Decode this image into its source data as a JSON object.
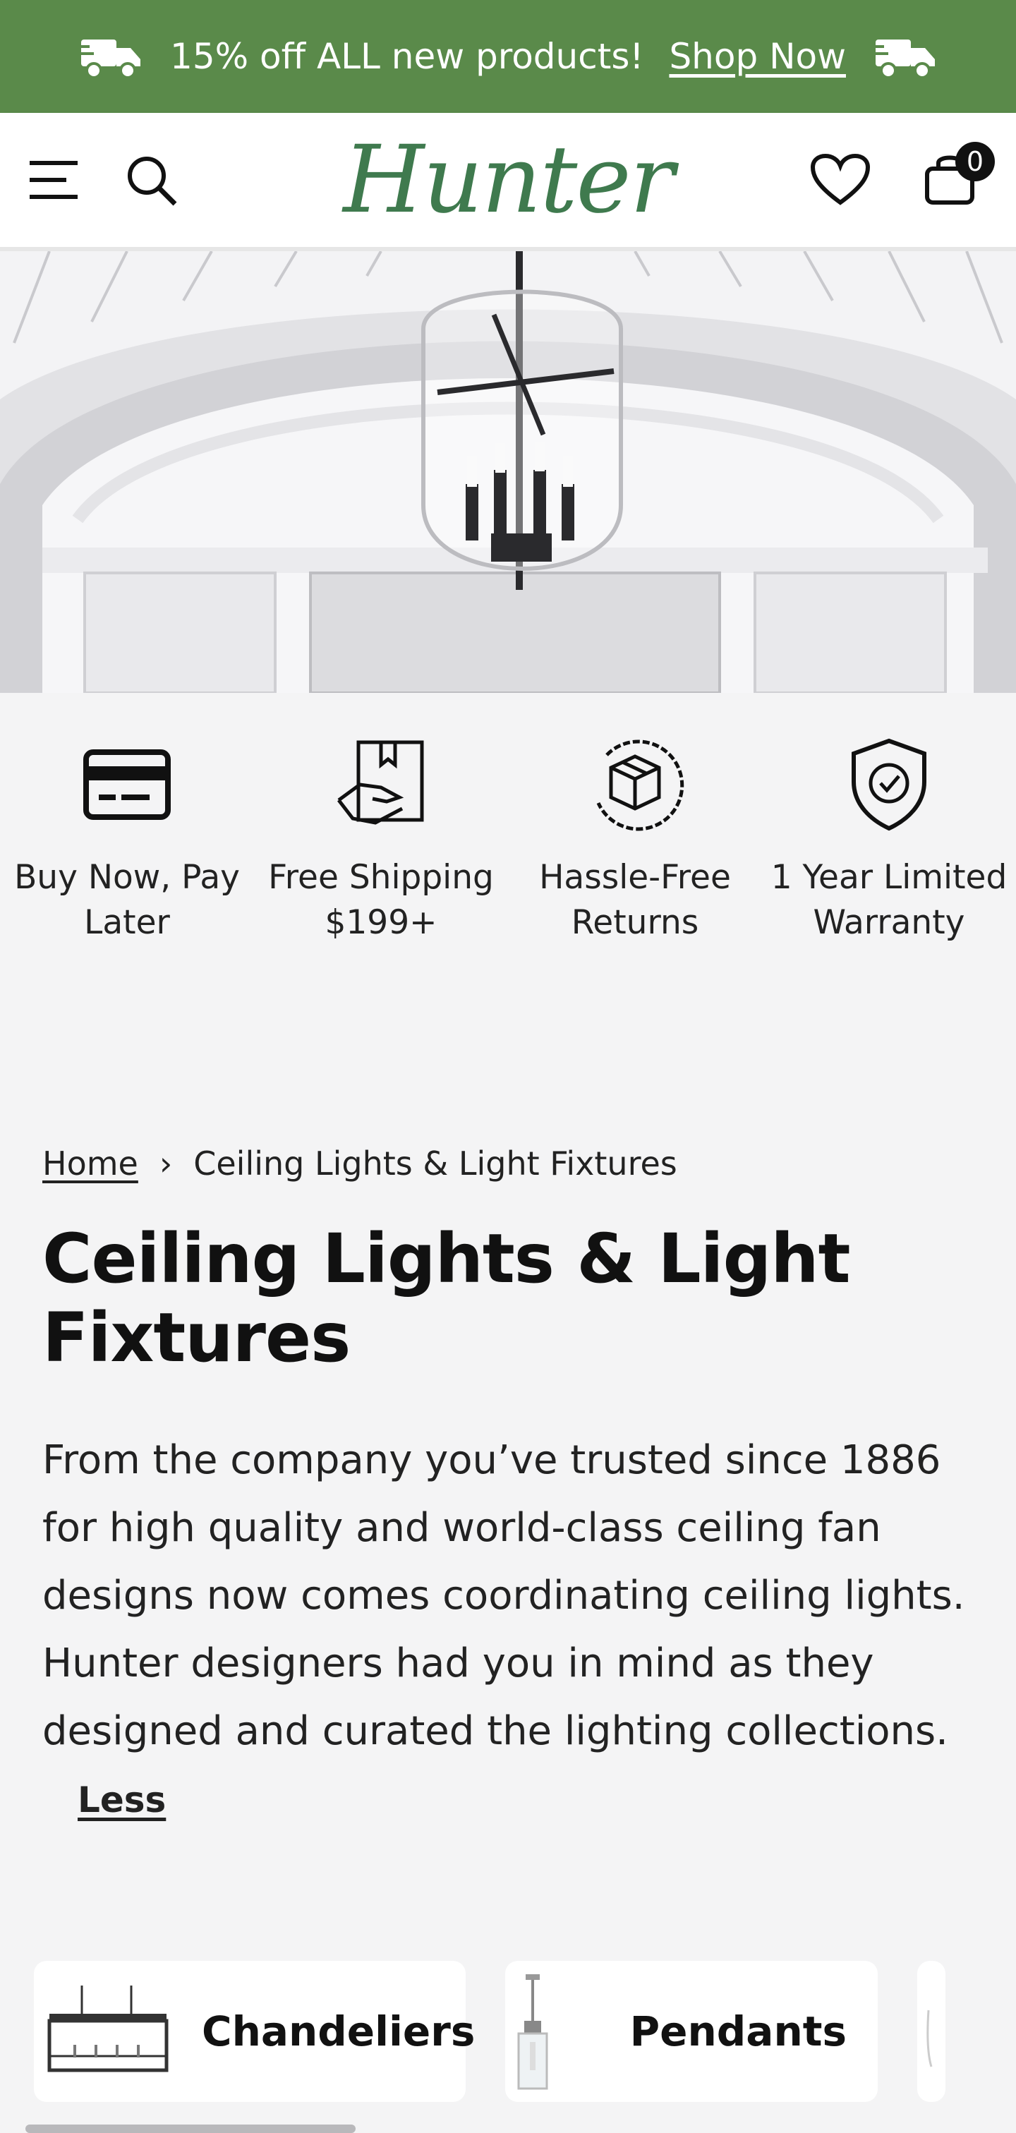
{
  "promo": {
    "text": "15% off ALL new products!",
    "link": "Shop Now",
    "icon": "delivery-truck-icon",
    "color": "#5a8a4a"
  },
  "header": {
    "logo": "Hunter",
    "cart_count": "0",
    "icons": [
      "menu-icon",
      "search-icon",
      "heart-icon",
      "cart-icon"
    ]
  },
  "benefits": [
    {
      "icon": "credit-card-icon",
      "label": "Buy Now, Pay Later"
    },
    {
      "icon": "shipping-box-hand-icon",
      "label": "Free Shipping $199+"
    },
    {
      "icon": "return-box-icon",
      "label": "Hassle-Free Returns"
    },
    {
      "icon": "shield-check-icon",
      "label": "1 Year Limited Warranty"
    }
  ],
  "breadcrumb": {
    "home": "Home",
    "separator": "›",
    "current": "Ceiling Lights & Light Fixtures"
  },
  "page_title": "Ceiling Lights & Light Fixtures",
  "description": {
    "text": "From the company you’ve trusted since 1886 for high quality and world-class ceiling fan designs now comes coordinating ceiling lights. Hunter designers had you in mind as they designed and curated the lighting collections.",
    "toggle": "Less"
  },
  "categories": [
    {
      "name": "Chandeliers"
    },
    {
      "name": "Pendants"
    },
    {
      "name": ""
    }
  ]
}
